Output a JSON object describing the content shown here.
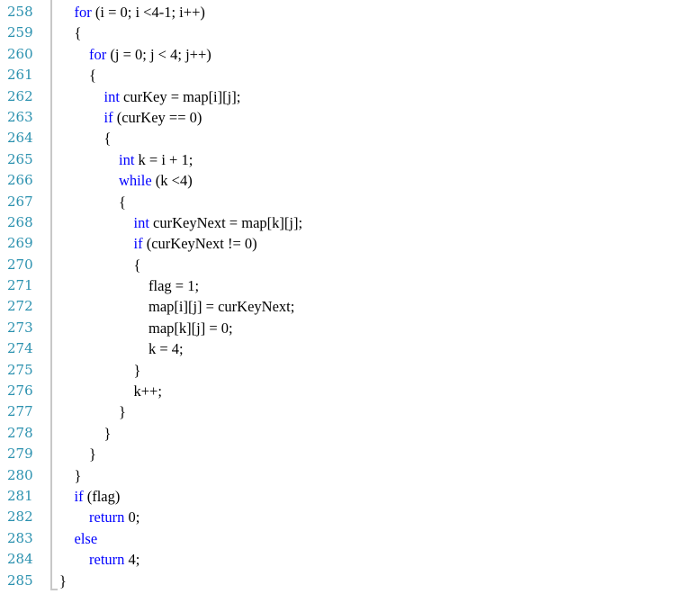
{
  "editor": {
    "colors": {
      "keyword": "#0000ff",
      "line_number": "#2b91af",
      "text": "#000000",
      "fold_guide": "#c8c8c8"
    },
    "lines": [
      {
        "num": "258",
        "indent": "    ",
        "kw": "for",
        "rest": " (i = 0; i <4-1; i++)"
      },
      {
        "num": "259",
        "indent": "    ",
        "kw": "",
        "rest": "{"
      },
      {
        "num": "260",
        "indent": "        ",
        "kw": "for",
        "rest": " (j = 0; j < 4; j++)"
      },
      {
        "num": "261",
        "indent": "        ",
        "kw": "",
        "rest": "{"
      },
      {
        "num": "262",
        "indent": "            ",
        "kw": "int",
        "rest": " curKey = map[i][j];"
      },
      {
        "num": "263",
        "indent": "            ",
        "kw": "if",
        "rest": " (curKey == 0)"
      },
      {
        "num": "264",
        "indent": "            ",
        "kw": "",
        "rest": "{"
      },
      {
        "num": "265",
        "indent": "                ",
        "kw": "int",
        "rest": " k = i + 1;"
      },
      {
        "num": "266",
        "indent": "                ",
        "kw": "while",
        "rest": " (k <4)"
      },
      {
        "num": "267",
        "indent": "                ",
        "kw": "",
        "rest": "{"
      },
      {
        "num": "268",
        "indent": "                    ",
        "kw": "int",
        "rest": " curKeyNext = map[k][j];"
      },
      {
        "num": "269",
        "indent": "                    ",
        "kw": "if",
        "rest": " (curKeyNext != 0)"
      },
      {
        "num": "270",
        "indent": "                    ",
        "kw": "",
        "rest": "{"
      },
      {
        "num": "271",
        "indent": "                        ",
        "kw": "",
        "rest": "flag = 1;"
      },
      {
        "num": "272",
        "indent": "                        ",
        "kw": "",
        "rest": "map[i][j] = curKeyNext;"
      },
      {
        "num": "273",
        "indent": "                        ",
        "kw": "",
        "rest": "map[k][j] = 0;"
      },
      {
        "num": "274",
        "indent": "                        ",
        "kw": "",
        "rest": "k = 4;"
      },
      {
        "num": "275",
        "indent": "                    ",
        "kw": "",
        "rest": "}"
      },
      {
        "num": "276",
        "indent": "                    ",
        "kw": "",
        "rest": "k++;"
      },
      {
        "num": "277",
        "indent": "                ",
        "kw": "",
        "rest": "}"
      },
      {
        "num": "278",
        "indent": "            ",
        "kw": "",
        "rest": "}"
      },
      {
        "num": "279",
        "indent": "        ",
        "kw": "",
        "rest": "}"
      },
      {
        "num": "280",
        "indent": "    ",
        "kw": "",
        "rest": "}"
      },
      {
        "num": "281",
        "indent": "    ",
        "kw": "if",
        "rest": " (flag)"
      },
      {
        "num": "282",
        "indent": "        ",
        "kw": "return",
        "rest": " 0;"
      },
      {
        "num": "283",
        "indent": "    ",
        "kw": "else",
        "rest": ""
      },
      {
        "num": "284",
        "indent": "        ",
        "kw": "return",
        "rest": " 4;"
      },
      {
        "num": "285",
        "indent": "",
        "kw": "",
        "rest": "}"
      }
    ]
  }
}
